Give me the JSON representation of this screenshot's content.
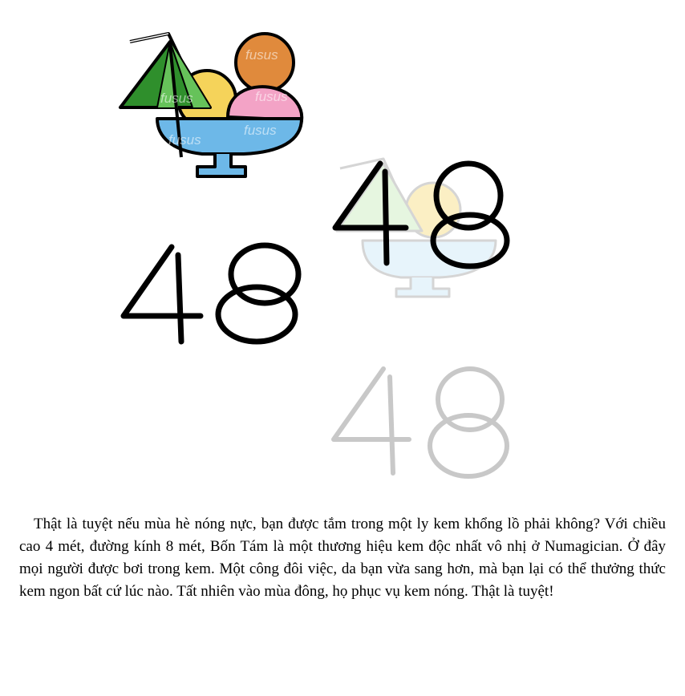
{
  "illustration": {
    "watermark": "fusus",
    "number_label": "48",
    "colors": {
      "umbrella_green": "#2f8f2c",
      "umbrella_light_green": "#66c25a",
      "scoop_orange": "#e08a3c",
      "scoop_yellow": "#f5d35a",
      "scoop_pink": "#f3a3c6",
      "glass_blue": "#6db8e8",
      "outline": "#000000",
      "faded_outline": "#c8c8c8"
    }
  },
  "story": {
    "text": "Thật là tuyệt nếu mùa hè nóng nực, bạn được tắm trong một ly kem khổng lồ phải không? Với chiều cao 4 mét, đường kính 8 mét, Bốn Tám là một thương hiệu kem độc nhất vô nhị ở Numagician. Ở đây mọi người được bơi trong kem. Một công đôi việc, da bạn vừa sang hơn, mà bạn lại có thể thưởng thức kem ngon bất cứ lúc nào. Tất nhiên vào mùa đông, họ phục vụ kem nóng. Thật là tuyệt!"
  }
}
